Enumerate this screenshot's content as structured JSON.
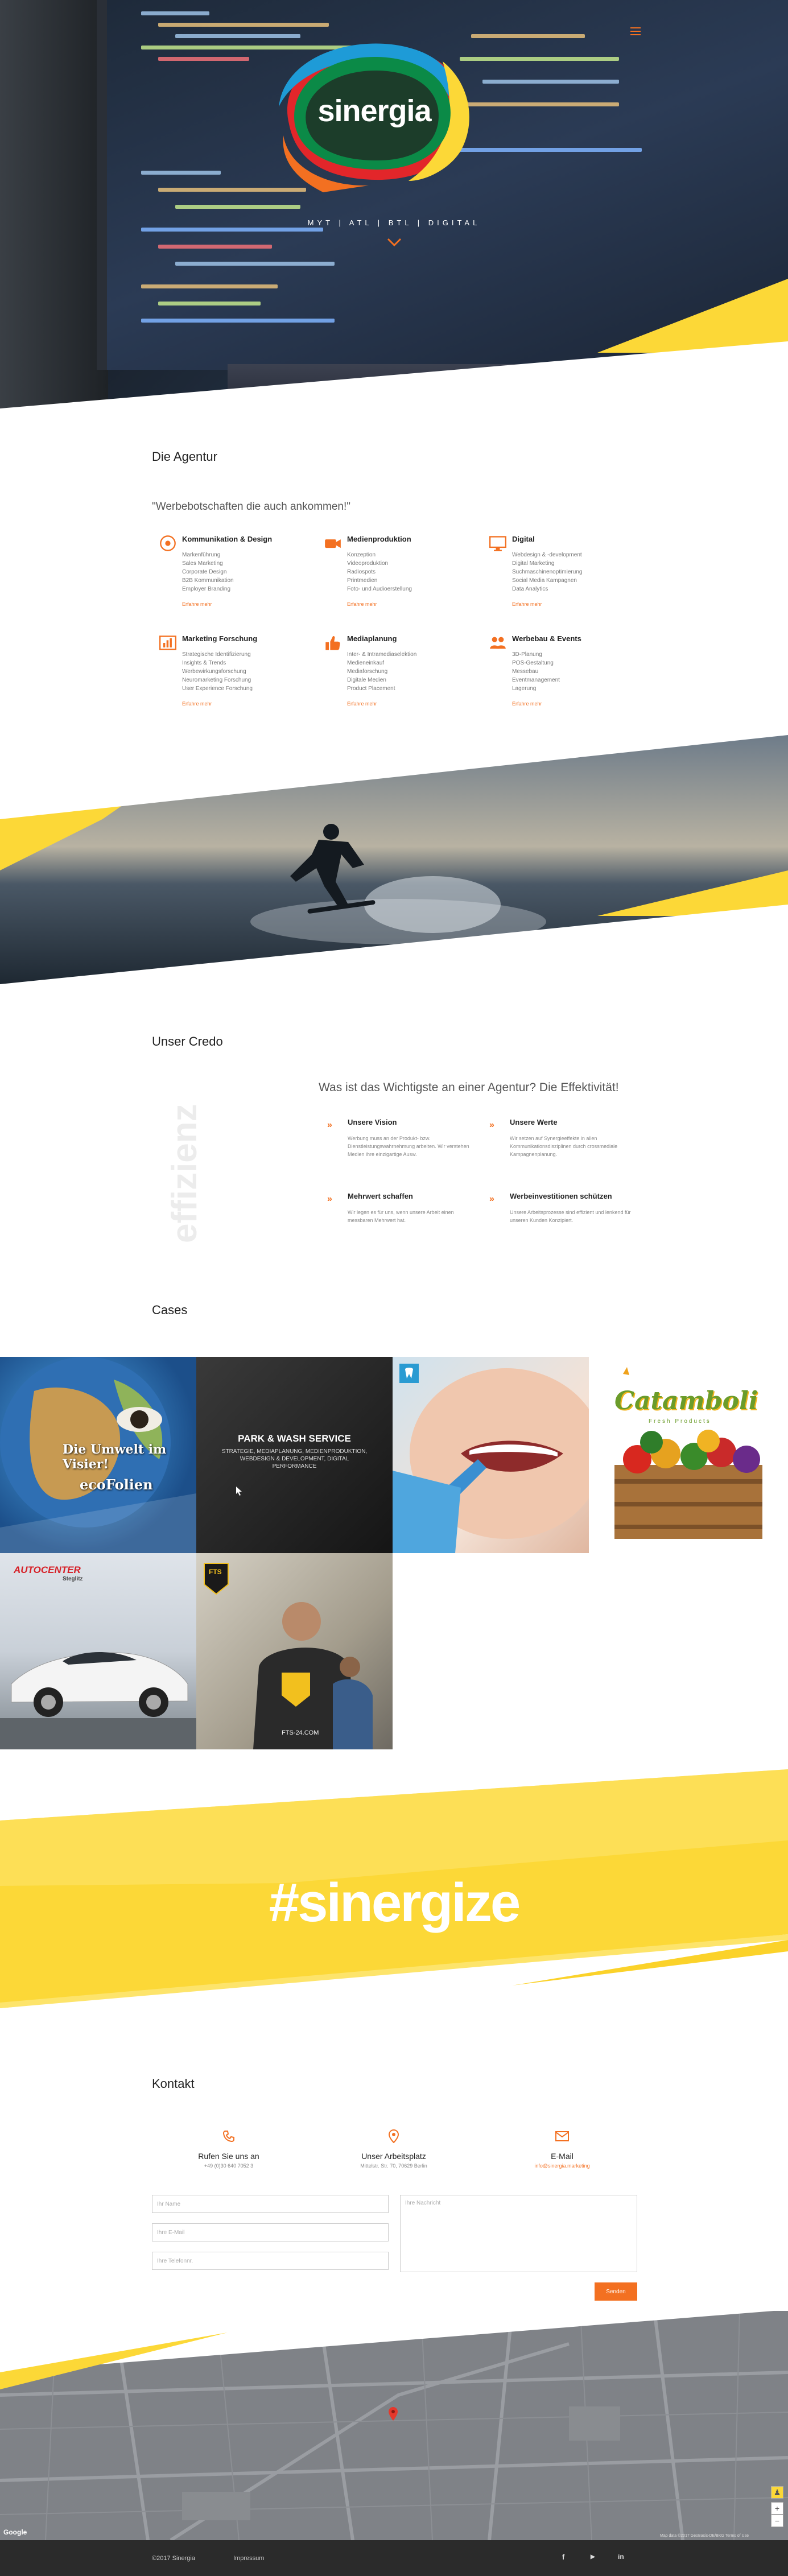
{
  "hero": {
    "brand": "sinergia",
    "tagline": "MYT  |  ATL  |  BTL  |  DIGITAL"
  },
  "agentur": {
    "title": "Die Agentur",
    "quote": "\"Werbebotschaften die auch ankommen!\"",
    "more_label": "Erfahre mehr",
    "services": [
      {
        "title": "Kommunikation & Design",
        "icon": "atom-icon",
        "items": [
          "Markenführung",
          "Sales Marketing",
          "Corporate Design",
          "B2B Kommunikation",
          "Employer Branding"
        ]
      },
      {
        "title": "Medienproduktion",
        "icon": "video-camera-icon",
        "items": [
          "Konzeption",
          "Videoproduktion",
          "Radiospots",
          "Printmedien",
          "Foto- und Audioerstellung"
        ]
      },
      {
        "title": "Digital",
        "icon": "monitor-icon",
        "items": [
          "Webdesign & -development",
          "Digital Marketing",
          "Suchmaschinenoptimierung",
          "Social Media Kampagnen",
          "Data Analytics"
        ]
      },
      {
        "title": "Marketing Forschung",
        "icon": "bar-chart-icon",
        "items": [
          "Strategische Identifizierung",
          "Insights & Trends",
          "Werbewirkungsforschung",
          "Neuromarketing Forschung",
          "User Experience Forschung"
        ]
      },
      {
        "title": "Mediaplanung",
        "icon": "thumbs-up-icon",
        "items": [
          "Inter- & Intramediaselektion",
          "Medieneinkauf",
          "Mediaforschung",
          "Digitale Medien",
          "Product Placement"
        ]
      },
      {
        "title": "Werbebau & Events",
        "icon": "people-icon",
        "items": [
          "3D-Planung",
          "POS-Gestaltung",
          "Messebau",
          "Eventmanagement",
          "Lagerung"
        ]
      }
    ]
  },
  "credo": {
    "title": "Unser Credo",
    "vertical_word": "effizienz",
    "question": "Was ist das Wichtigste an einer Agentur? Die Effektivität!",
    "values": [
      {
        "title": "Unsere Vision",
        "text": "Werbung muss an der Produkt- bzw. Dienstleistungswahrnehmung arbeiten. Wir verstehen Medien ihre einzigartige Ausw."
      },
      {
        "title": "Unsere Werte",
        "text": "Wir setzen auf Synergieeffekte in allen Kommunikationsdisziplinen durch crossmediale Kampagnenplanung."
      },
      {
        "title": "Mehrwert schaffen",
        "text": "Wir legen es für uns, wenn unsere Arbeit einen messbaren Mehrwert hat."
      },
      {
        "title": "Werbeinvestitionen schützen",
        "text": "Unsere Arbeitsprozesse sind effizient und lenkend für unseren Kunden Konzipiert."
      }
    ]
  },
  "cases": {
    "title": "Cases",
    "items": [
      {
        "name": "ecoFolien",
        "label_1": "Die Umwelt im Visier!",
        "label_2": "ecoFolien"
      },
      {
        "name": "Park & Wash Service",
        "label_1": "PARK & WASH SERVICE",
        "label_2": "STRATEGIE, MEDIAPLANUNG, MEDIENPRODUKTION, WEBDESIGN & DEVELOPMENT, DIGITAL PERFORMANCE"
      },
      {
        "name": "Zahnarzt",
        "label_1": "",
        "label_2": ""
      },
      {
        "name": "Catamboli",
        "label_1": "Catamboli",
        "label_2": "Fresh Products"
      },
      {
        "name": "Autocenter Steglitz",
        "label_1": "AUTOCENTER",
        "label_2": "Steglitz"
      },
      {
        "name": "FTS",
        "label_1": "FTS",
        "label_2": "FTS-24.COM"
      }
    ]
  },
  "sinergize": {
    "hashtag": "#sinergize"
  },
  "kontakt": {
    "title": "Kontakt",
    "items": [
      {
        "title": "Rufen Sie uns an",
        "text": "+49 (0)30 640 7052 3",
        "icon": "phone-icon"
      },
      {
        "title": "Unser Arbeitsplatz",
        "text": "Mittelstr. Str. 70, 70629 Berlin",
        "icon": "map-pin-icon"
      },
      {
        "title": "E-Mail",
        "text": "info@sinergia.marketing",
        "icon": "mail-icon"
      }
    ],
    "form": {
      "name_placeholder": "Ihr Name",
      "email_placeholder": "Ihre E-Mail",
      "phone_placeholder": "Ihre Telefonnr.",
      "message_placeholder": "Ihre Nachricht",
      "send_label": "Senden"
    }
  },
  "map": {
    "google": "Google",
    "zoom_in": "+",
    "zoom_out": "−",
    "terms": "Map data ©2017 GeoBasis-DE/BKG   Terms of Use"
  },
  "footer": {
    "copyright": "©2017 Sinergia",
    "impressum": "Impressum",
    "social": [
      "f",
      "▶",
      "in"
    ]
  },
  "colors": {
    "accent": "#f37021",
    "yellow": "#fcd837",
    "footer": "#2b2b2b"
  }
}
